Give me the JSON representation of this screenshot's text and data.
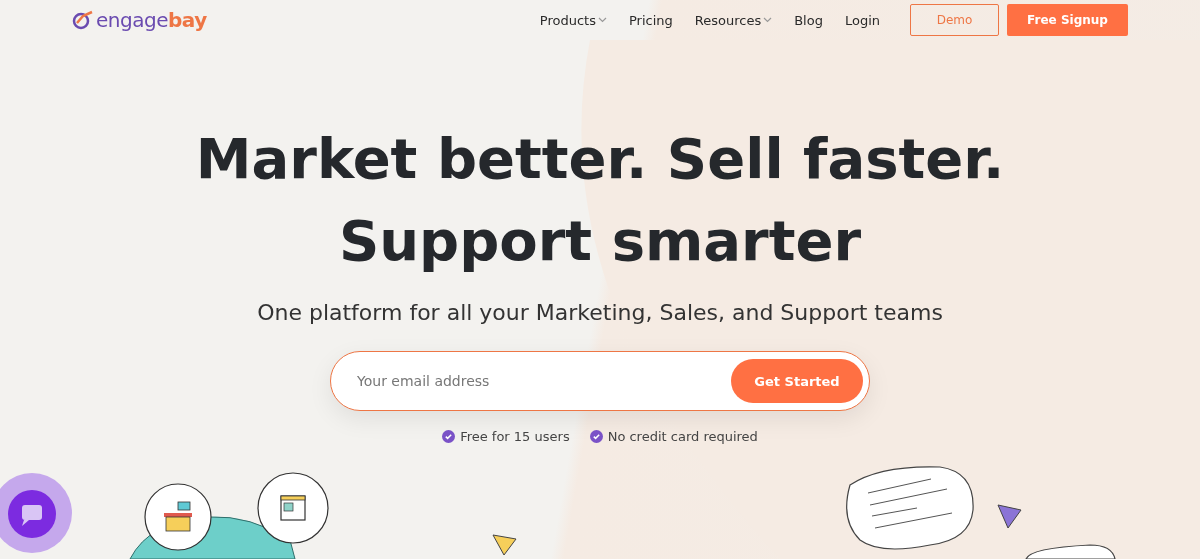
{
  "logo": {
    "text": "engage",
    "accent": "bay"
  },
  "nav": [
    {
      "label": "Products",
      "has_dropdown": true
    },
    {
      "label": "Pricing",
      "has_dropdown": false
    },
    {
      "label": "Resources",
      "has_dropdown": true
    },
    {
      "label": "Blog",
      "has_dropdown": false
    },
    {
      "label": "Login",
      "has_dropdown": false
    }
  ],
  "header_buttons": [
    {
      "label": "Demo",
      "kind": "outline"
    },
    {
      "label": "Free Signup",
      "kind": "filled"
    }
  ],
  "hero": {
    "title_lines": [
      "Market better. Sell faster.",
      "Support smarter"
    ],
    "subtitle": "One platform for all your Marketing, Sales, and Support teams",
    "email": {
      "placeholder": "Your email address"
    },
    "cta": "Get Started",
    "features": [
      "Free for 15 users",
      "No credit card required"
    ]
  }
}
